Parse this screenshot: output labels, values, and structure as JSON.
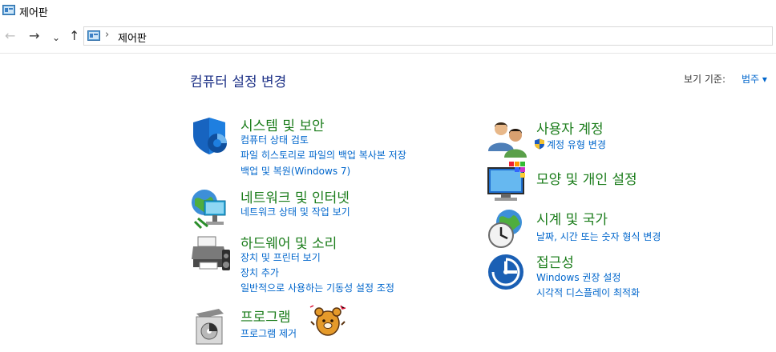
{
  "window": {
    "title": "제어판"
  },
  "nav": {
    "back_icon": "←",
    "forward_icon": "→",
    "recent_icon": "⌄",
    "up_icon": "↑",
    "address_separator": "›",
    "breadcrumb": "제어판"
  },
  "header": {
    "heading": "컴퓨터 설정 변경",
    "view_by_label": "보기 기준:",
    "view_by_value": "범주 ▾"
  },
  "categories": [
    {
      "icon": "security-shield-icon",
      "title": "시스템 및 보안",
      "links": [
        "컴퓨터 상태 검토",
        "파일 히스토리로 파일의 백업 복사본 저장",
        "백업 및 복원(Windows 7)"
      ]
    },
    {
      "icon": "network-globe-icon",
      "title": "네트워크 및 인터넷",
      "links": [
        "네트워크 상태 및 작업 보기"
      ]
    },
    {
      "icon": "printer-speaker-icon",
      "title": "하드웨어 및 소리",
      "links": [
        "장치 및 프린터 보기",
        "장치 추가",
        "일반적으로 사용하는 기동성 설정 조정"
      ]
    },
    {
      "icon": "programs-disc-icon",
      "title": "프로그램",
      "links": [
        "프로그램 제거"
      ]
    },
    {
      "icon": "users-icon",
      "title": "사용자 계정",
      "links": [
        "계정 유형 변경"
      ]
    },
    {
      "icon": "display-colors-icon",
      "title": "모양 및 개인 설정",
      "links": []
    },
    {
      "icon": "globe-clock-icon",
      "title": "시계 및 국가",
      "links": [
        "날짜, 시간 또는 숫자 형식 변경"
      ]
    },
    {
      "icon": "ease-of-access-icon",
      "title": "접근성",
      "links": [
        "Windows 권장 설정",
        "시각적 디스플레이 최적화"
      ]
    }
  ],
  "colors": {
    "heading": "#1e3287",
    "category_title": "#1a7c1a",
    "link": "#0066cc"
  }
}
